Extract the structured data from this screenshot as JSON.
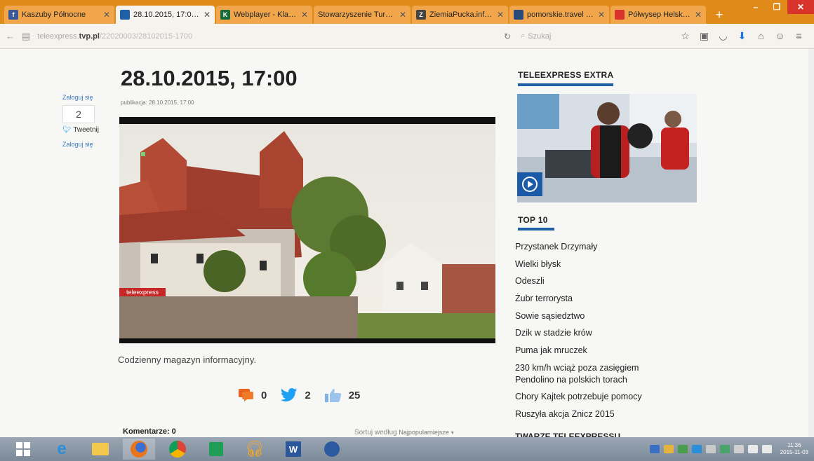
{
  "tabs": [
    {
      "title": "Kaszuby Północne",
      "fav_color": "#3b5998",
      "fav_glyph": "f",
      "active": false
    },
    {
      "title": "28.10.2015, 17:00 -...",
      "fav_color": "#1e5fa8",
      "fav_glyph": "",
      "active": true
    },
    {
      "title": "Webplayer - Klassi...",
      "fav_color": "#1a6b3a",
      "fav_glyph": "K",
      "active": false
    },
    {
      "title": "Stowarzyszenie Turyst...",
      "fav_color": "",
      "fav_glyph": "",
      "active": false
    },
    {
      "title": "ZiemiaPucka.info -...",
      "fav_color": "#444",
      "fav_glyph": "Z",
      "active": false
    },
    {
      "title": "pomorskie.travel |...",
      "fav_color": "#2a4a7a",
      "fav_glyph": "",
      "active": false
    },
    {
      "title": "Półwysep Helski, ...",
      "fav_color": "#d9342b",
      "fav_glyph": "",
      "active": false
    }
  ],
  "address": {
    "prefix": "teleexpress.",
    "host": "tvp.pl",
    "path": "/22020003/28102015-1700"
  },
  "search": {
    "placeholder": "Szukaj"
  },
  "social": {
    "login_top": "Zaloguj się",
    "share_count": "2",
    "tweet_label": "Tweetnij",
    "login_bottom": "Zaloguj się"
  },
  "article": {
    "title": "28.10.2015, 17:00",
    "published": "publikacja: 28.10.2015, 17:00",
    "video_logo": "teleexpress",
    "description": "Codzienny magazyn informacyjny.",
    "stats": {
      "comments": "0",
      "tweets": "2",
      "likes": "25"
    },
    "comments_label": "Komentarze: 0",
    "sort_label": "Sortuj według",
    "sort_value": "Najpopularniejsze"
  },
  "sidebar": {
    "extra_heading": "TELEEXPRESS EXTRA",
    "top10_heading": "TOP 10",
    "top10": [
      "Przystanek Drzymały",
      "Wielki błysk",
      "Odeszli",
      "Żubr terrorysta",
      "Sowie sąsiedztwo",
      "Dzik w stadzie krów",
      "Puma jak mruczek",
      "230 km/h wciąż poza zasięgiem Pendolino na polskich torach",
      "Chory Kajtek potrzebuje pomocy",
      "Ruszyła akcja Znicz 2015"
    ],
    "twarze_heading": "TWARZE TELEEXPRESSU"
  },
  "taskbar": {
    "apps": [
      "start-button",
      "internet-explorer-icon",
      "file-explorer-icon",
      "firefox-icon",
      "chrome-icon",
      "store-icon",
      "headphones-app-icon",
      "word-icon",
      "settings-app-icon"
    ],
    "time": "11:36",
    "date": "2015-11-03"
  },
  "colors": {
    "accent": "#1e5fa8",
    "tab_strip": "#e08a1a"
  }
}
